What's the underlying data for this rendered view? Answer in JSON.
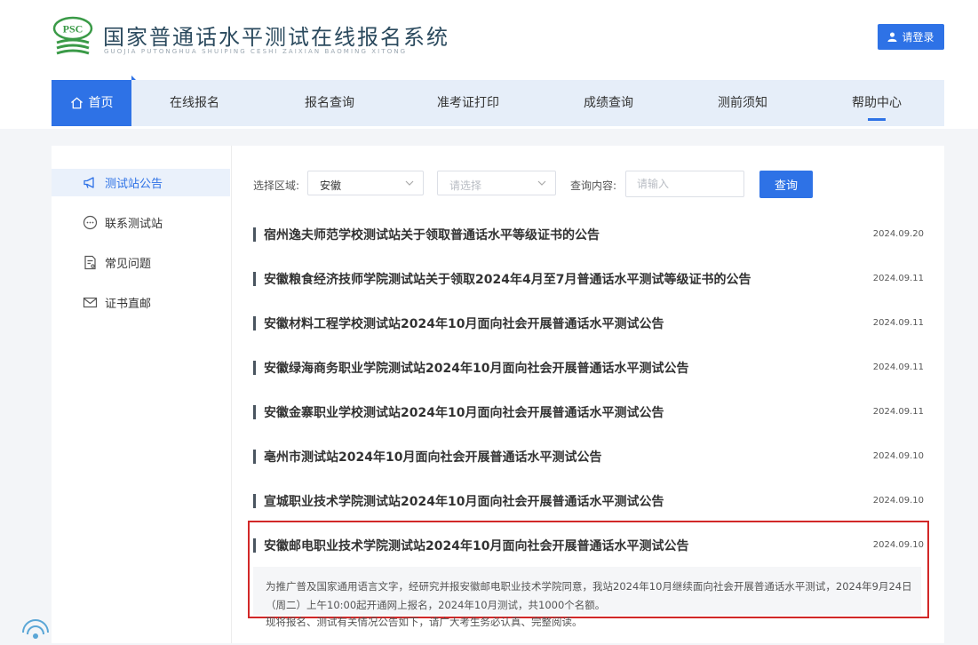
{
  "header": {
    "logo_text": "PSC",
    "title": "国家普通话水平测试在线报名系统",
    "subtitle": "GUOJIA PUTONGHUA SHUIPING CESHI ZAIXIAN BAOMING XITONG",
    "login_label": "请登录"
  },
  "nav": {
    "items": [
      "首页",
      "在线报名",
      "报名查询",
      "准考证打印",
      "成绩查询",
      "测前须知",
      "帮助中心"
    ],
    "active": "首页",
    "current_section": "帮助中心"
  },
  "sidebar": {
    "items": [
      {
        "label": "测试站公告",
        "icon": "megaphone-icon"
      },
      {
        "label": "联系测试站",
        "icon": "chat-icon"
      },
      {
        "label": "常见问题",
        "icon": "document-icon"
      },
      {
        "label": "证书直邮",
        "icon": "mail-icon"
      }
    ],
    "active": "测试站公告"
  },
  "filters": {
    "region_label": "选择区域:",
    "region_value": "安徽",
    "region2_placeholder": "请选择",
    "content_label": "查询内容:",
    "content_placeholder": "请输入",
    "query_button": "查询"
  },
  "notices": [
    {
      "title": "宿州逸夫师范学校测试站关于领取普通话水平等级证书的公告",
      "date": "2024.09.20"
    },
    {
      "title": "安徽粮食经济技师学院测试站关于领取2024年4月至7月普通话水平测试等级证书的公告",
      "date": "2024.09.11"
    },
    {
      "title": "安徽材料工程学校测试站2024年10月面向社会开展普通话水平测试公告",
      "date": "2024.09.11"
    },
    {
      "title": "安徽绿海商务职业学院测试站2024年10月面向社会开展普通话水平测试公告",
      "date": "2024.09.11"
    },
    {
      "title": "安徽金寨职业学校测试站2024年10月面向社会开展普通话水平测试公告",
      "date": "2024.09.11"
    },
    {
      "title": "亳州市测试站2024年10月面向社会开展普通话水平测试公告",
      "date": "2024.09.10"
    },
    {
      "title": "宣城职业技术学院测试站2024年10月面向社会开展普通话水平测试公告",
      "date": "2024.09.10"
    },
    {
      "title": "安徽邮电职业技术学院测试站2024年10月面向社会开展普通话水平测试公告",
      "date": "2024.09.10"
    }
  ],
  "expanded_summary": "为推广普及国家通用语言文字，经研究并报安徽邮电职业技术学院同意，我站2024年10月继续面向社会开展普通话水平测试，2024年9月24日（周二）上午10:00起开通网上报名，2024年10月测试，共1000个名额。",
  "summary_cutoff_line": "现将报名、测试有关情况公告如下，请广大考生务必认真、完整阅读。",
  "colors": {
    "accent": "#2e72e6",
    "highlight_border": "#d22828",
    "nav_bg": "#e6eef9"
  }
}
